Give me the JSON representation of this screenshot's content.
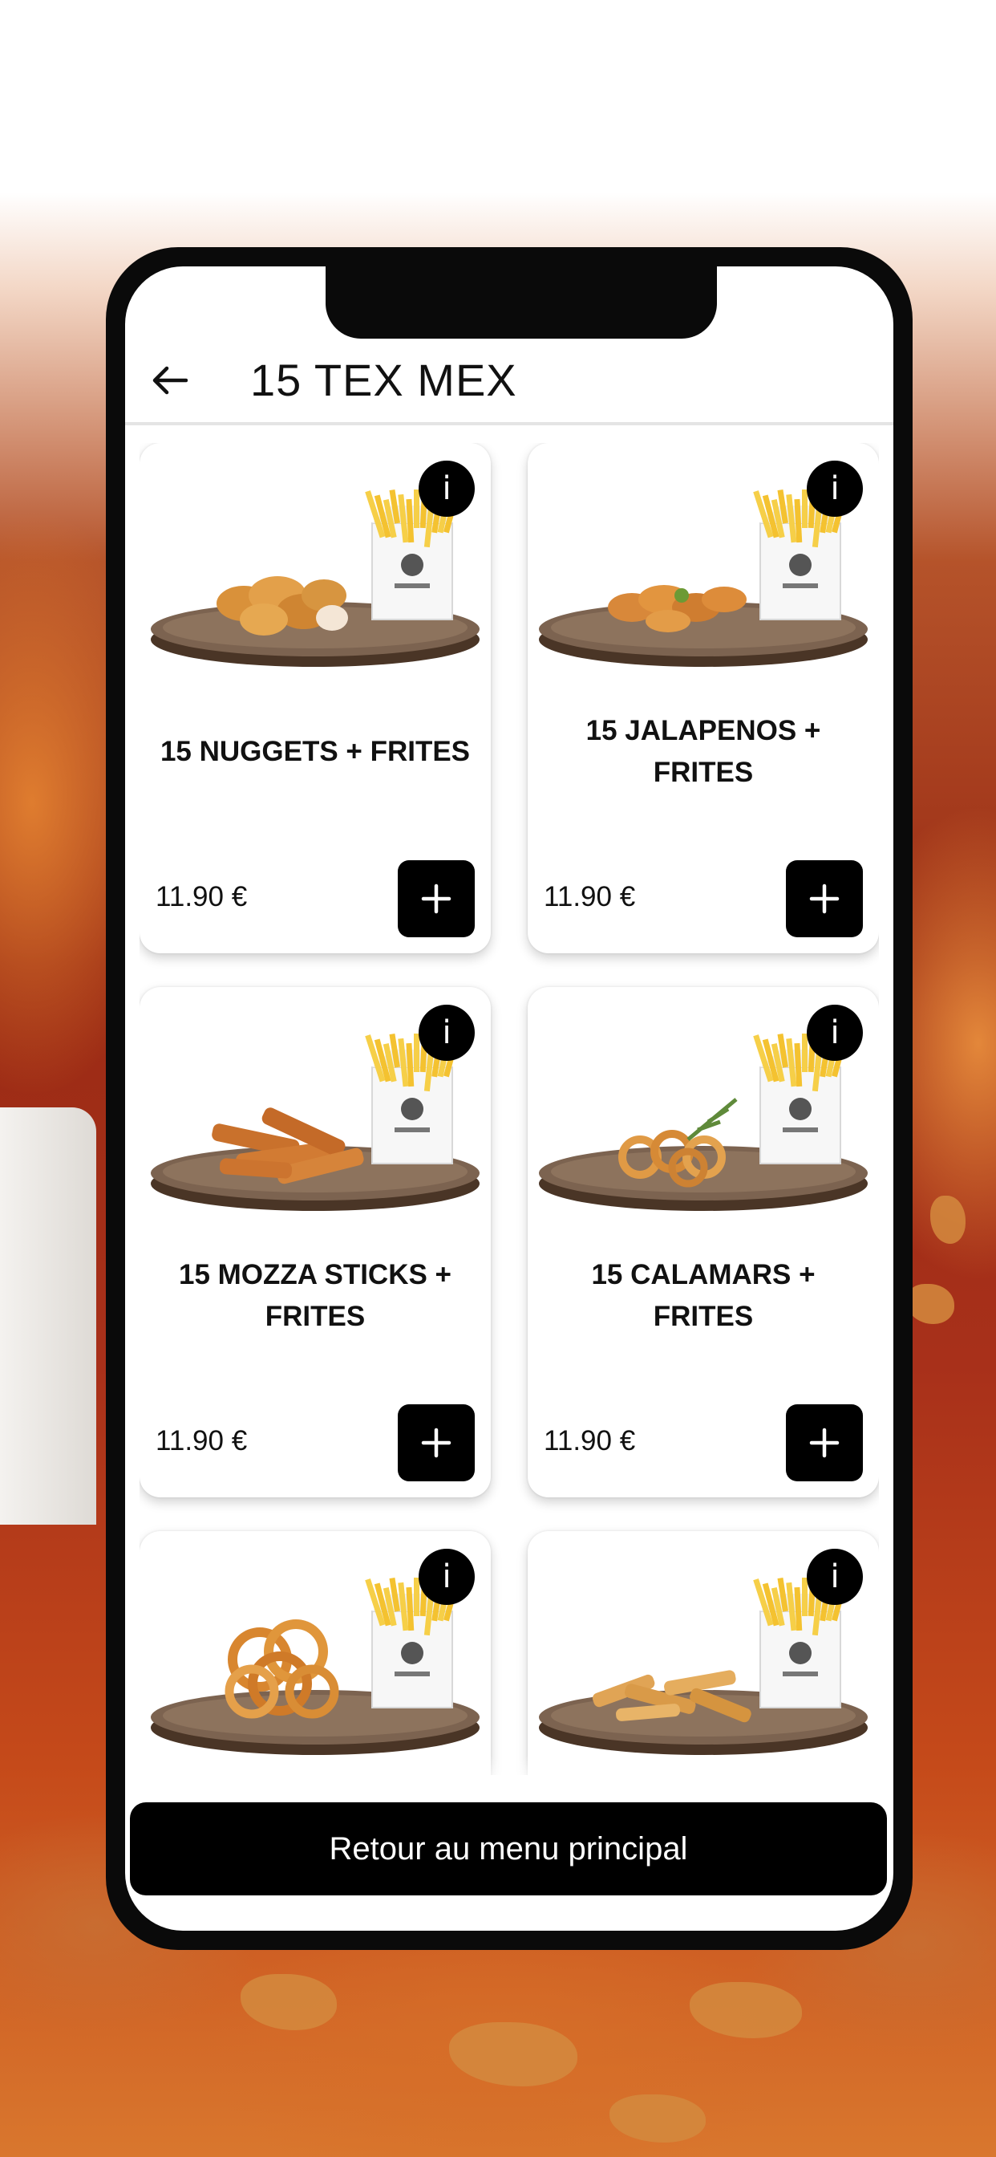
{
  "header": {
    "title": "15 TEX MEX",
    "back_icon": "arrow-left-icon"
  },
  "products": [
    {
      "name": "15 NUGGETS + FRITES",
      "price": "11.90 €",
      "food": "nuggets"
    },
    {
      "name": "15 JALAPENOS + FRITES",
      "price": "11.90 €",
      "food": "jalapenos"
    },
    {
      "name": "15 MOZZA STICKS + FRITES",
      "price": "11.90 €",
      "food": "sticks"
    },
    {
      "name": "15 CALAMARS + FRITES",
      "price": "11.90 €",
      "food": "calamars"
    },
    {
      "name": "",
      "price": "",
      "food": "onion-rings"
    },
    {
      "name": "",
      "price": "",
      "food": "tenders"
    }
  ],
  "info_label": "i",
  "footer": {
    "back_label": "Retour au menu principal"
  },
  "colors": {
    "accent": "#000000",
    "background_top": "#ffffff",
    "background_mid": "#9a2b14"
  }
}
